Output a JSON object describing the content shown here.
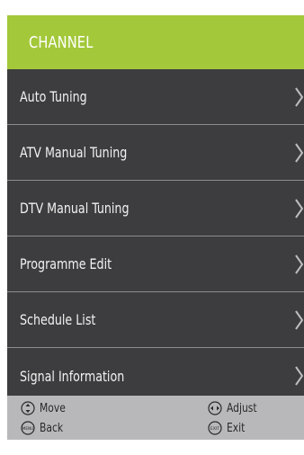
{
  "header": {
    "title": "CHANNEL"
  },
  "menu": {
    "items": [
      {
        "label": "Auto Tuning",
        "icon": "chevron-right-icon"
      },
      {
        "label": "ATV Manual Tuning",
        "icon": "chevron-right-icon"
      },
      {
        "label": "DTV Manual Tuning",
        "icon": "chevron-right-icon"
      },
      {
        "label": "Programme Edit",
        "icon": "chevron-right-icon"
      },
      {
        "label": "Schedule List",
        "icon": "chevron-right-icon"
      },
      {
        "label": "Signal Information",
        "icon": "chevron-right-icon"
      }
    ]
  },
  "footer": {
    "move": {
      "label": "Move",
      "icon": "up-down-arrows-icon"
    },
    "back": {
      "label": "Back",
      "icon": "menu-button-icon",
      "icon_text": "MENU"
    },
    "adjust": {
      "label": "Adjust",
      "icon": "left-right-arrows-icon"
    },
    "exit": {
      "label": "Exit",
      "icon": "exit-button-icon",
      "icon_text": "EXIT"
    }
  },
  "colors": {
    "header_bg": "#a3c83a",
    "menu_bg": "#3d3d3f",
    "footer_bg": "#b8b8ba",
    "divider": "#8c8c8c"
  }
}
